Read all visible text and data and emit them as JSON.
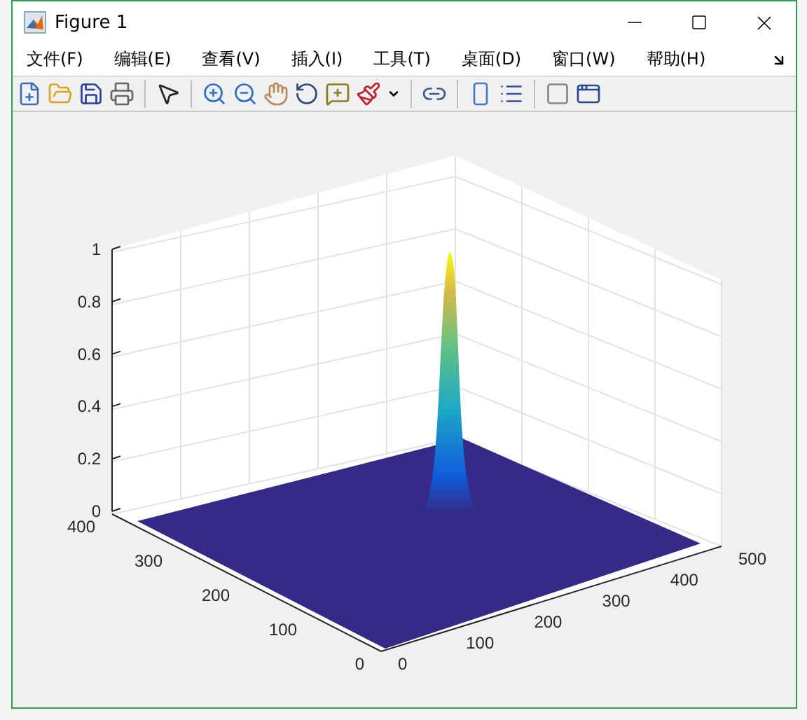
{
  "window": {
    "title": "Figure 1"
  },
  "menu": [
    "文件(F)",
    "编辑(E)",
    "查看(V)",
    "插入(I)",
    "工具(T)",
    "桌面(D)",
    "窗口(W)",
    "帮助(H)"
  ],
  "axes": {
    "z_ticks": [
      "1",
      "0.8",
      "0.6",
      "0.4",
      "0.2",
      "0"
    ],
    "y_ticks": [
      "0",
      "100",
      "200",
      "300",
      "400"
    ],
    "x_ticks": [
      "0",
      "100",
      "200",
      "300",
      "400",
      "500"
    ]
  }
}
